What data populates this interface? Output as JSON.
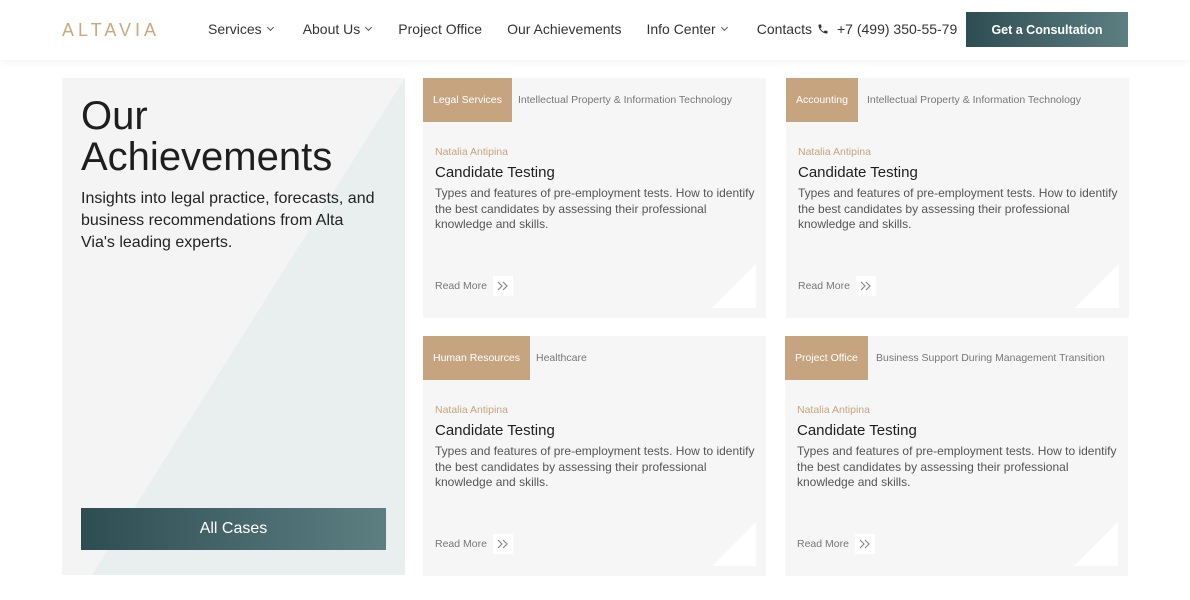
{
  "header": {
    "logo": "ALTAVIA",
    "nav": [
      {
        "label": "Services",
        "dropdown": true
      },
      {
        "label": "About Us",
        "dropdown": true
      },
      {
        "label": "Project Office",
        "dropdown": false
      },
      {
        "label": "Our Achievements",
        "dropdown": false
      },
      {
        "label": "Info Center",
        "dropdown": true
      },
      {
        "label": "Contacts",
        "dropdown": false
      }
    ],
    "phone": "+7 (499) 350-55-79",
    "cta": "Get a Consultation"
  },
  "intro": {
    "title": "Our Achievements",
    "description": "Insights into legal practice, forecasts, and business recommendations from Alta Via's leading experts.",
    "button": "All Cases"
  },
  "cards": [
    {
      "tag": "Legal Services",
      "category": "Intellectual Property & Information Technology",
      "author": "Natalia Antipina",
      "title": "Candidate Testing",
      "description": "Types and features of pre-employment tests. How to identify the best candidates by assessing their professional knowledge and skills.",
      "read_more": "Read More"
    },
    {
      "tag": "Accounting",
      "category": "Intellectual Property & Information Technology",
      "author": "Natalia Antipina",
      "title": "Candidate Testing",
      "description": "Types and features of pre-employment tests. How to identify the best candidates by assessing their professional knowledge and skills.",
      "read_more": "Read More"
    },
    {
      "tag": "Human Resources",
      "category": "Healthcare",
      "author": "Natalia Antipina",
      "title": "Candidate Testing",
      "description": "Types and features of pre-employment tests. How to identify the best candidates by assessing their professional knowledge and skills.",
      "read_more": "Read More"
    },
    {
      "tag": "Project Office",
      "category": "Business Support During Management Transition",
      "author": "Natalia Antipina",
      "title": "Candidate Testing",
      "description": "Types and features of pre-employment tests. How to identify the best candidates by assessing their professional knowledge and skills.",
      "read_more": "Read More"
    }
  ],
  "colors": {
    "accent": "#c6a47f",
    "button_dark": "#2e4d52",
    "button_light": "#5d7f82",
    "panel_bg": "#f3f4f3",
    "card_bg": "#f6f6f6"
  },
  "icons": [
    "phone-icon",
    "chevron-down-icon",
    "double-chevron-right-icon"
  ]
}
